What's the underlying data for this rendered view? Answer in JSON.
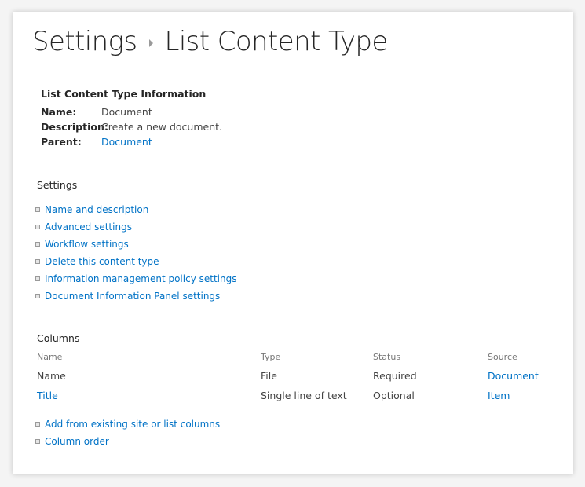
{
  "header": {
    "breadcrumb_root": "Settings",
    "page_title": "List Content Type"
  },
  "info": {
    "heading": "List Content Type Information",
    "name_label": "Name:",
    "name_value": "Document",
    "description_label": "Description:",
    "description_value": "Create a new document.",
    "parent_label": "Parent:",
    "parent_value": "Document"
  },
  "settings": {
    "title": "Settings",
    "links": [
      "Name and description",
      "Advanced settings",
      "Workflow settings",
      "Delete this content type",
      "Information management policy settings",
      "Document Information Panel settings"
    ]
  },
  "columns": {
    "title": "Columns",
    "headers": [
      "Name",
      "Type",
      "Status",
      "Source"
    ],
    "rows": [
      {
        "name": "Name",
        "type": "File",
        "status": "Required",
        "source": "Document"
      },
      {
        "name": "Title",
        "type": "Single line of text",
        "status": "Optional",
        "source": "Item"
      }
    ],
    "links": [
      "Add from existing site or list columns",
      "Column order"
    ]
  },
  "colors": {
    "link": "#0072c6",
    "text": "#444444",
    "heading": "#262626"
  }
}
